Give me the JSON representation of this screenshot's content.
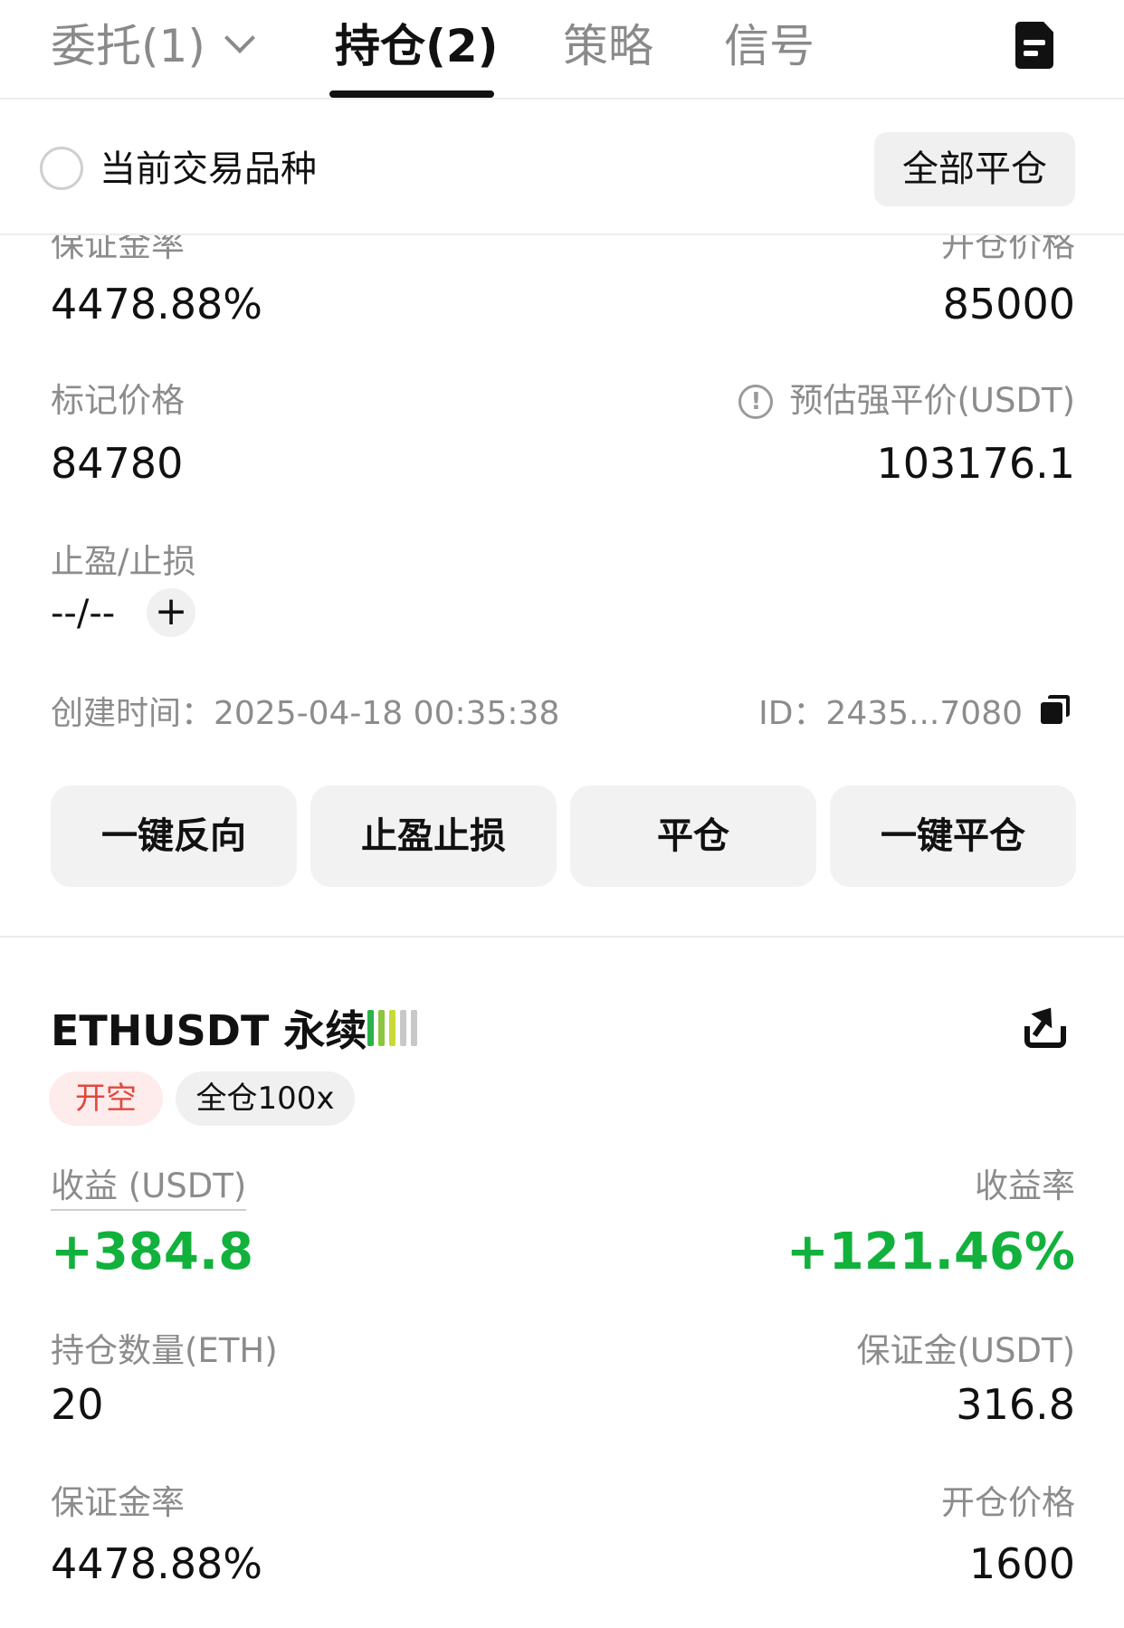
{
  "tabs": {
    "orders": "委托(1)",
    "positions": "持仓(2)",
    "strategy": "策略",
    "signals": "信号"
  },
  "filter": {
    "current_symbol_label": "当前交易品种",
    "close_all_label": "全部平仓"
  },
  "position1": {
    "margin_ratio_label": "保证金率",
    "margin_ratio_value": "4478.88%",
    "open_price_label": "开仓价格",
    "open_price_value": "85000",
    "mark_price_label": "标记价格",
    "mark_price_value": "84780",
    "est_liq_price_label": "预估强平价(USDT)",
    "est_liq_price_value": "103176.1",
    "tp_sl_label": "止盈/止损",
    "tp_sl_value": "--/--",
    "created_time": "创建时间：2025-04-18 00:35:38",
    "id": "ID：2435...7080",
    "actions": {
      "reverse": "一键反向",
      "tp_sl": "止盈止损",
      "close": "平仓",
      "quick_close": "一键平仓"
    }
  },
  "position2": {
    "symbol": "ETHUSDT 永续",
    "side_tag": "开空",
    "margin_mode_tag": "全仓100x",
    "pnl_label": "收益 (USDT)",
    "pnl_value": "+384.8",
    "roe_label": "收益率",
    "roe_value": "+121.46%",
    "qty_label": "持仓数量(ETH)",
    "qty_value": "20",
    "margin_label": "保证金(USDT)",
    "margin_value": "316.8",
    "margin_ratio_label": "保证金率",
    "margin_ratio_value": "4478.88%",
    "open_price_label": "开仓价格",
    "open_price_value": "1600"
  },
  "icons": {
    "chevron": "chevron-down-icon",
    "doc": "document-icon",
    "info": "info-icon",
    "copy": "copy-icon",
    "share": "share-icon",
    "signal": "signal-bars-icon",
    "plus": "plus-icon"
  },
  "colors": {
    "profit_green": "#11b13c",
    "short_red": "#e0483e",
    "short_tag_bg": "#fdeceb",
    "button_bg": "#f2f2f2",
    "muted_text": "#8c8c8c"
  }
}
